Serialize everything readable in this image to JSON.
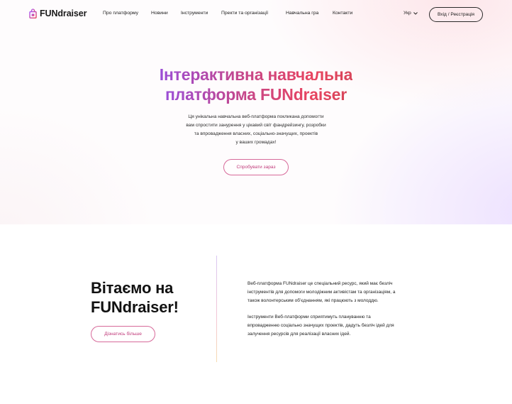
{
  "header": {
    "logo_text": "FUNdraiser",
    "nav": [
      {
        "label": "Про платформу"
      },
      {
        "label": "Новини"
      },
      {
        "label": "Інструменти"
      },
      {
        "label": "Пректи та організації"
      },
      {
        "label": "Навчальна гра"
      },
      {
        "label": "Контакти"
      }
    ],
    "language": "Укр",
    "login_label": "Вхід / Реєстрація"
  },
  "hero": {
    "title_line1": "Інтерактивна навчальна",
    "title_line2": "платформа FUNdraiser",
    "description": [
      "Ця унікальна навчальна веб-платформа покликана допомогти",
      "вам спростити занурення у цікавий світ фандрейзингу, розробки",
      "та впровадження власних, соціально-значущих, проектів",
      "у ваших громадах!"
    ],
    "cta_label": "Спробувати зараз"
  },
  "welcome": {
    "title_line1": "Вітаємо на",
    "title_line2": "FUNdraiser!",
    "button_label": "Дізнатись більше",
    "paragraph1": [
      "Веб-платформа FUNdraiser це спеціальний ресурс, який має безліч",
      "інструментів для допомоги молодіжним активістам та організаціям, а",
      "також волонтерським об’єднанням, які працюють з молоддю."
    ],
    "paragraph2": [
      "Інструменти Веб-платформи сприятимуть плануванню та",
      "впровадженню соціально значущих проектів, дадуть безліч ідей для",
      "залучення ресурсів для реалізації власних ідей."
    ]
  },
  "colors": {
    "accent_pink": "#d76a9a",
    "accent_text": "#c03a7a",
    "gradient_start": "#9b4dd6",
    "gradient_end": "#e8445f"
  },
  "icons": {
    "logo": "shopping-bag-icon",
    "language_dropdown": "chevron-down-icon"
  }
}
